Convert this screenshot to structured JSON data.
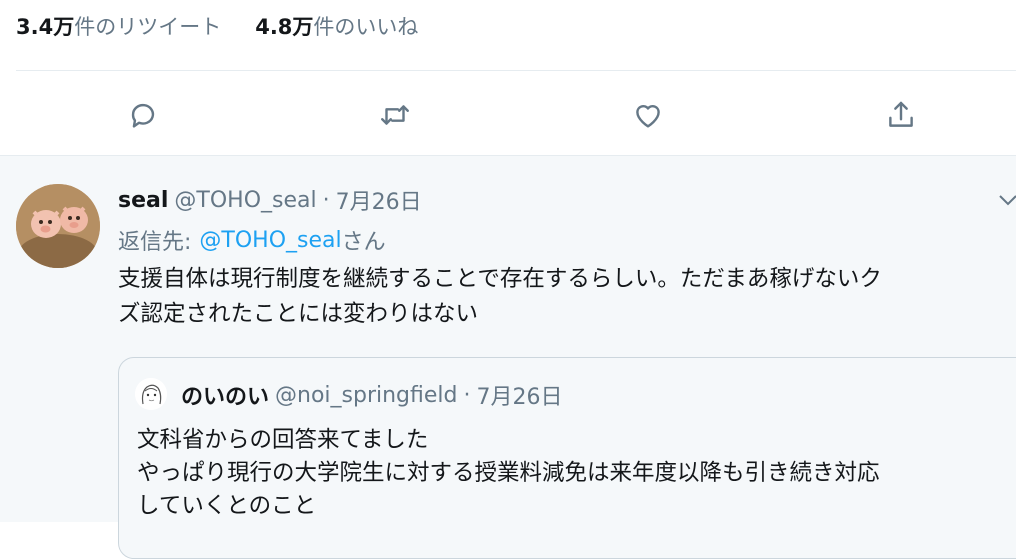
{
  "stats": {
    "retweets_count": "3.4万",
    "retweets_label": "件のリツイート",
    "likes_count": "4.8万",
    "likes_label": "件のいいね"
  },
  "actions": [
    "reply-icon",
    "retweet-icon",
    "like-icon",
    "share-icon"
  ],
  "reply_tweet": {
    "name": "seal",
    "handle": "@TOHO_seal",
    "separator": "·",
    "date": "7月26日",
    "reply_to_prefix": "返信先:",
    "reply_to_handle": "@TOHO_seal",
    "reply_to_suffix": "さん",
    "text_lines": [
      "支援自体は現行制度を継続することで存在するらしい。ただまあ稼げないク",
      "ズ認定されたことには変わりはない"
    ]
  },
  "quoted_tweet": {
    "name": "のいのい",
    "handle": "@noi_springfield",
    "separator": "·",
    "date": "7月26日",
    "text_lines": [
      "文科省からの回答来てました",
      "やっぱり現行の大学院生に対する授業料減免は来年度以降も引き続き対応",
      "していくとのこと"
    ]
  },
  "colors": {
    "link": "#1da1f2",
    "secondary_text": "#657786",
    "primary_text": "#14171a",
    "divider": "#e6ecf0",
    "reply_background": "#f5f8fa"
  }
}
